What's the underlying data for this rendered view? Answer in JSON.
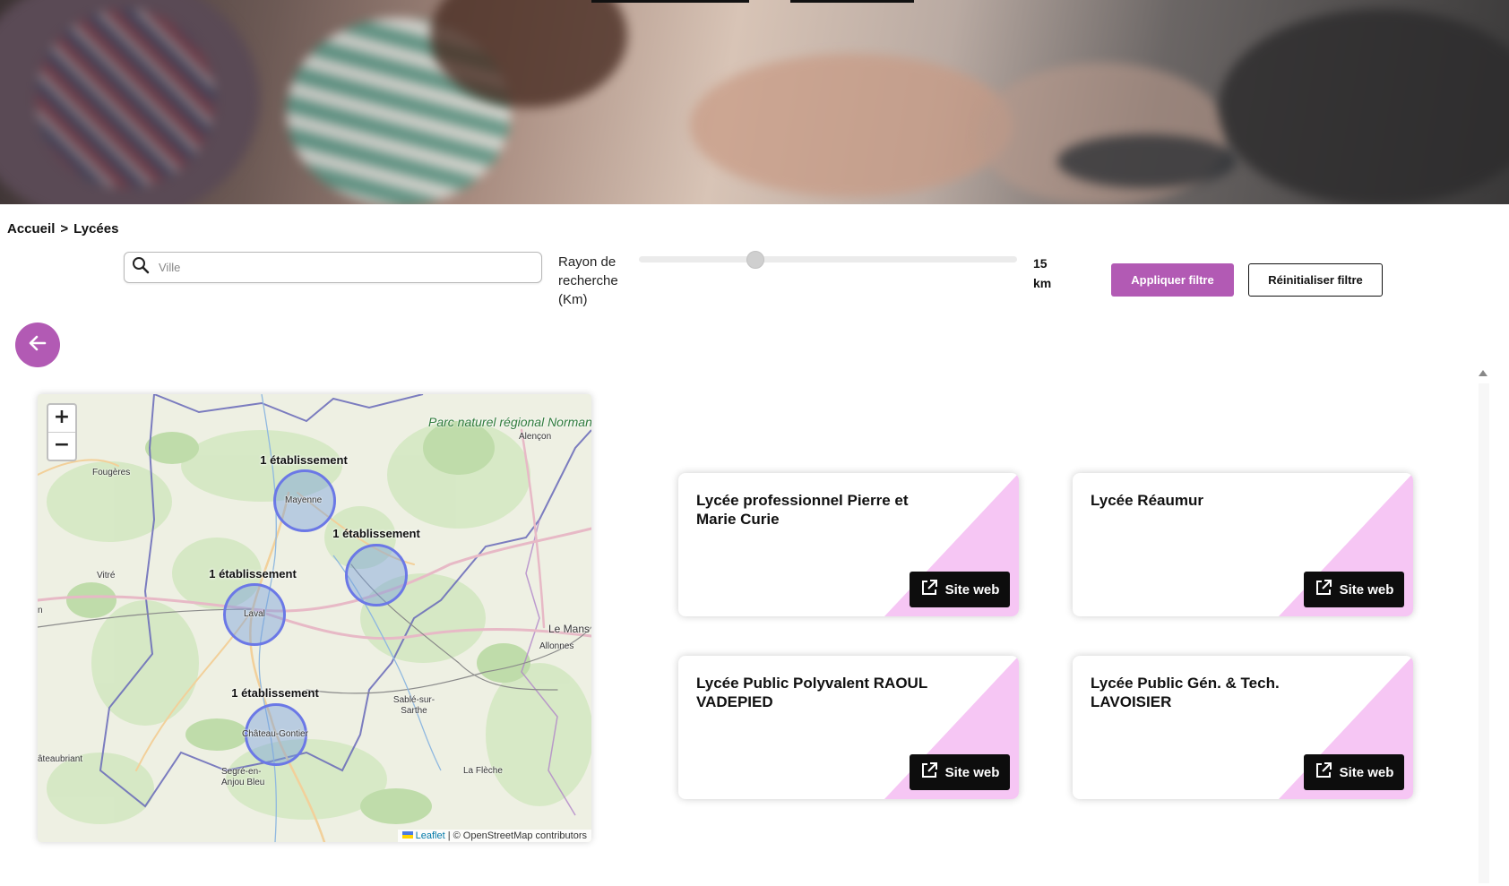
{
  "breadcrumb": {
    "home": "Accueil",
    "separator": ">",
    "current": "Lycées"
  },
  "filters": {
    "city_placeholder": "Ville",
    "radius_label": "Rayon de recherche (Km)",
    "radius_value": 15,
    "radius_unit": "km",
    "apply_label": "Appliquer filtre",
    "reset_label": "Réinitialiser filtre"
  },
  "map": {
    "zoom_in": "+",
    "zoom_out": "−",
    "clusters": [
      {
        "label": "1 établissement",
        "place": "Mayenne"
      },
      {
        "label": "1 établissement",
        "place": ""
      },
      {
        "label": "1 établissement",
        "place": "Laval"
      },
      {
        "label": "1 établissement",
        "place": "Château-Gontier"
      }
    ],
    "places": {
      "fougeres": "Fougères",
      "vitre": "Vitré",
      "alencon": "Alençon",
      "park": "Parc naturel régional Normandie-Maine",
      "le_mans": "Le Mans",
      "allonnes": "Allonnes",
      "sable": "Sablé-sur-Sarthe",
      "la_fleche": "La Flèche",
      "segre": "Segré-en-Anjou Bleu",
      "chateaubriant": "âteaubriant",
      "west_edge": "n"
    },
    "attribution": {
      "leaflet": "Leaflet",
      "rest": "| © OpenStreetMap contributors"
    }
  },
  "cards": [
    {
      "title": "Lycée professionnel Pierre et Marie Curie",
      "button": "Site web"
    },
    {
      "title": "Lycée Réaumur",
      "button": "Site web"
    },
    {
      "title": "Lycée Public Polyvalent RAOUL VADEPIED",
      "button": "Site web"
    },
    {
      "title": "Lycée Public Gén. & Tech. LAVOISIER",
      "button": "Site web"
    }
  ],
  "colors": {
    "accent": "#b25ab4",
    "card_corner": "#f6c6f4",
    "cluster_border": "#6b78e6"
  },
  "icons": {
    "search": "search-icon",
    "back": "arrow-left-icon",
    "external": "external-link-icon"
  }
}
